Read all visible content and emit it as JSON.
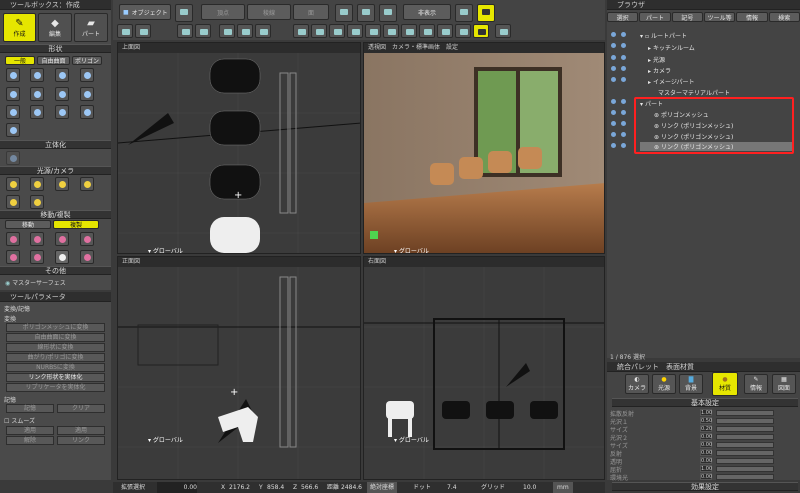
{
  "toolbox": {
    "title": "ツールボックス：作成",
    "tabs": [
      "作成",
      "編集",
      "パート"
    ],
    "section_shape": "形状",
    "shape_modes": [
      "一般",
      "自由曲面",
      "ポリゴン"
    ],
    "section_solid": "立体化",
    "section_light_camera": "光源/カメラ",
    "section_move_copy": "移動/複製",
    "move_copy_modes": [
      "移動",
      "複製"
    ],
    "section_other": "その他",
    "master_surface": "マスターサーフェス"
  },
  "toolparam": {
    "title": "ツールパラメータ",
    "header": "変換/記憶",
    "convert_label": "変換",
    "buttons": [
      "ポリゴンメッシュに変換",
      "自由曲面に変換",
      "線形状に変換",
      "曲がり/ポリゴに変換",
      "NURBSに変換",
      "リンク形状を実体化",
      "リプリケータを実体化"
    ],
    "memory_label": "記憶",
    "mem_buttons": [
      "記憶",
      "クリア"
    ],
    "smooth_label": "スムーズ",
    "smooth_buttons": [
      "適用",
      "適用",
      "解除",
      "リンク"
    ]
  },
  "toolbar": {
    "object_menu": "オブジェクト",
    "items": [
      "頂点",
      "稜線",
      "面"
    ],
    "display_menu": "非表示"
  },
  "viewports": {
    "top": "上面図",
    "perspective": "透視図　カメラ・標準画体　設定",
    "front": "正面図",
    "right": "右面図",
    "global": "▾ グローバル"
  },
  "browser": {
    "title": "ブラウザ",
    "tabs": [
      "選択",
      "パート",
      "記号",
      "ツール等",
      "情報",
      "検索"
    ],
    "tree": [
      "ルートパート",
      "キッチンルーム",
      "光源",
      "カメラ",
      "イメージパート",
      "マスターマテリアルパート",
      "パート",
      "ポリゴンメッシュ",
      "リンク (ポリゴンメッシュ)",
      "リンク (ポリゴンメッシュ)",
      "リンク (ポリゴンメッシュ)"
    ],
    "count": "1 / 876 選択"
  },
  "integrated": {
    "title": "統合パレット　表面材質",
    "tabs": [
      "カメラ",
      "光源",
      "背景",
      "材質",
      "情報",
      "図面"
    ],
    "basic_section": "基本設定",
    "rows": [
      {
        "label": "拡散反射",
        "value": "1.00"
      },
      {
        "label": "光沢１",
        "value": "0.50"
      },
      {
        "label": "サイズ",
        "value": "0.20"
      },
      {
        "label": "光沢２",
        "value": "0.00"
      },
      {
        "label": "サイズ",
        "value": "0.00"
      },
      {
        "label": "反射",
        "value": "0.00"
      },
      {
        "label": "透明",
        "value": "0.00"
      },
      {
        "label": "屈折",
        "value": "1.00"
      },
      {
        "label": "環境光",
        "value": "0.00"
      }
    ],
    "effect_section": "効果設定"
  },
  "statusbar": {
    "mode_label": "拡張選択",
    "mode_value": "0.00",
    "x_label": "X",
    "x_value": "2176.2",
    "y_label": "Y",
    "y_value": "858.4",
    "z_label": "Z",
    "z_value": "566.6",
    "dist_label": "距離",
    "dist_value": "2484.6",
    "coord_mode": "絶対座標",
    "dot_label": "ドット",
    "dot_value": "7.4",
    "grid_label": "グリッド",
    "grid_value": "10.0",
    "unit": "mm"
  },
  "colors": {
    "highlight": "#e6e600",
    "selection_outline": "#ff2020"
  }
}
